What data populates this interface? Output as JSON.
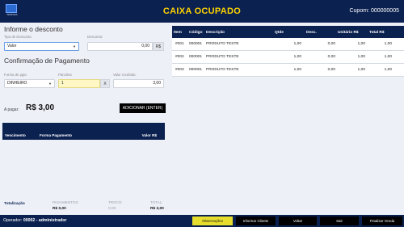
{
  "header": {
    "logo_text": "SIMPLES",
    "status": "CAIXA OCUPADO",
    "coupon_label": "Cupom:",
    "coupon_number": "000000005"
  },
  "discount": {
    "title": "Informe o desconto",
    "type_label": "Tipo de Desconto:",
    "type_value": "Valor",
    "amount_label": "Desconto:",
    "amount_value": "0,00",
    "currency": "R$"
  },
  "payment": {
    "title": "Confirmação de Pagamento",
    "method_label": "Forma de pgto",
    "method_value": "DINHEIRO",
    "installments_label": "Parcelas",
    "installments_value": "1",
    "clear_label": "X",
    "received_label": "Valor recebido:",
    "received_value": "3,00",
    "to_pay_label": "A pagar:",
    "to_pay_value": "R$ 3,00",
    "add_button": "ADICIONAR (ENTER)",
    "table_headers": [
      "Vencimento",
      "Forma Pagamento",
      "Valor R$"
    ]
  },
  "totals": {
    "label": "Totalização",
    "payments_label": "PAGAMENTOS:",
    "payments_value": "R$ 0,00",
    "change_label": "TROCO:",
    "change_value": "0,00",
    "total_label": "TOTAL:",
    "total_value": "R$ 3,00"
  },
  "items": {
    "headers": [
      "Item",
      "Código",
      "Descrição",
      "Qtde",
      "Desc.",
      "Unitário R$",
      "Total R$"
    ],
    "rows": [
      {
        "item": "#001",
        "code": "000001",
        "desc": "PRODUTO TESTE",
        "qty": "1,00",
        "discount": "0,00",
        "unit": "1,00",
        "total": "1,00"
      },
      {
        "item": "#002",
        "code": "000001",
        "desc": "PRODUTO TESTE",
        "qty": "1,00",
        "discount": "0,00",
        "unit": "1,00",
        "total": "1,00"
      },
      {
        "item": "#003",
        "code": "000001",
        "desc": "PRODUTO TESTE",
        "qty": "1,00",
        "discount": "0,00",
        "unit": "1,00",
        "total": "1,00"
      }
    ]
  },
  "footer": {
    "operator_label": "Operador:",
    "operator_value": "00002 - administrador",
    "buttons": [
      "Observações",
      "Informar Cliente",
      "Voltar",
      "Sair",
      "Finalizar Venda"
    ]
  },
  "colors": {
    "navy": "#0b2150",
    "status_yellow": "#ffd400",
    "observations_button": "#e6dd2c"
  },
  "icons": [
    "logo",
    "chevron-down-icon"
  ]
}
